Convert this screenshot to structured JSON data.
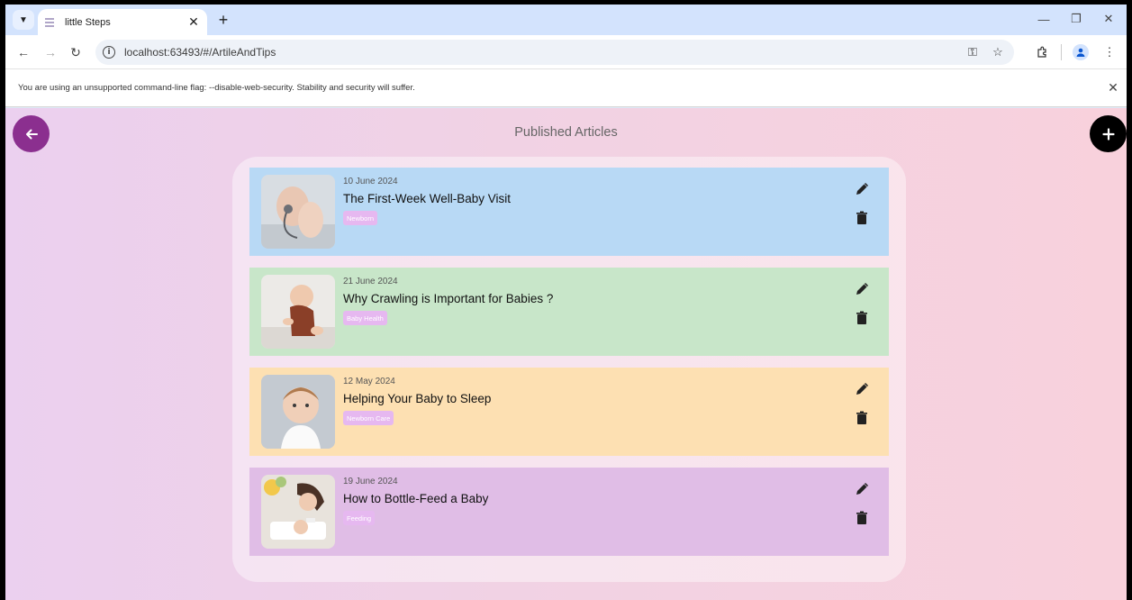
{
  "browser": {
    "tab_title": "little Steps",
    "url": "localhost:63493/#/ArtileAndTips",
    "infobar_message": "You are using an unsupported command-line flag: --disable-web-security. Stability and security will suffer."
  },
  "app": {
    "page_title": "Published Articles",
    "articles": [
      {
        "date": "10 June 2024",
        "title": "The First-Week Well-Baby Visit",
        "tag": "Newborn",
        "color": "#b8d9f5"
      },
      {
        "date": "21 June 2024",
        "title": "Why Crawling is Important for Babies ?",
        "tag": "Baby Health",
        "color": "#c8e6c9"
      },
      {
        "date": "12 May 2024",
        "title": "Helping Your Baby to Sleep",
        "tag": "Newborn Care",
        "color": "#fde0b2"
      },
      {
        "date": "19 June 2024",
        "title": "How to Bottle-Feed a Baby",
        "tag": "Feeding",
        "color": "#e0bde6"
      }
    ]
  },
  "colors": {
    "back_fab": "#8b2f8f",
    "add_fab": "#000000",
    "tag_bg": "#e6b8f0"
  }
}
